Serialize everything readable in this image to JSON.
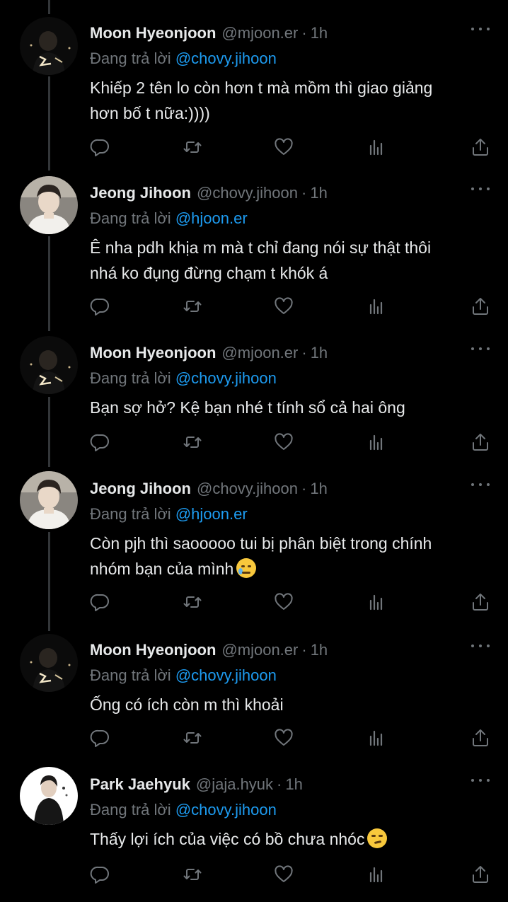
{
  "colors": {
    "background": "#000000",
    "text": "#e7e9ea",
    "muted": "#71767b",
    "link": "#1d9bf0",
    "thread_line": "#333639"
  },
  "reply_prefix": "Đang trả lời",
  "tweets": [
    {
      "name": "Moon Hyeonjoon",
      "handle": "@mjoon.er",
      "time": "1h",
      "reply_to": "@chovy.jihoon",
      "text": "Khiếp 2 tên lo còn hơn t mà mồm thì giao giảng\nhơn bố t nữa:))))",
      "avatar": "dark-night-photo-avatar"
    },
    {
      "name": "Jeong Jihoon",
      "handle": "@chovy.jihoon",
      "time": "1h",
      "reply_to": "@hjoon.er",
      "text": "Ê nha pdh khịa m mà t chỉ đang nói sự thật thôi\nnhá ko đụng đừng chạm t khók á",
      "avatar": "person-white-shirt-avatar"
    },
    {
      "name": "Moon Hyeonjoon",
      "handle": "@mjoon.er",
      "time": "1h",
      "reply_to": "@chovy.jihoon",
      "text": "Bạn sợ hở? Kệ bạn nhé t tính sổ cả hai ông",
      "avatar": "dark-night-photo-avatar"
    },
    {
      "name": "Jeong Jihoon",
      "handle": "@chovy.jihoon",
      "time": "1h",
      "reply_to": "@hjoon.er",
      "text": "Còn pjh thì saooooo tui bị phân biệt trong chính\nnhóm bạn của mình",
      "emoji": "crying-face-emoji",
      "avatar": "person-white-shirt-avatar"
    },
    {
      "name": "Moon Hyeonjoon",
      "handle": "@mjoon.er",
      "time": "1h",
      "reply_to": "@chovy.jihoon",
      "text": "Ống có ích còn m thì khoải",
      "avatar": "dark-night-photo-avatar"
    },
    {
      "name": "Park Jaehyuk",
      "handle": "@jaja.hyuk",
      "time": "1h",
      "reply_to": "@chovy.jihoon",
      "text": "Thấy lợi ích của việc có bồ chưa nhóc",
      "emoji": "smirking-face-emoji",
      "avatar": "person-dark-jacket-avatar"
    }
  ]
}
